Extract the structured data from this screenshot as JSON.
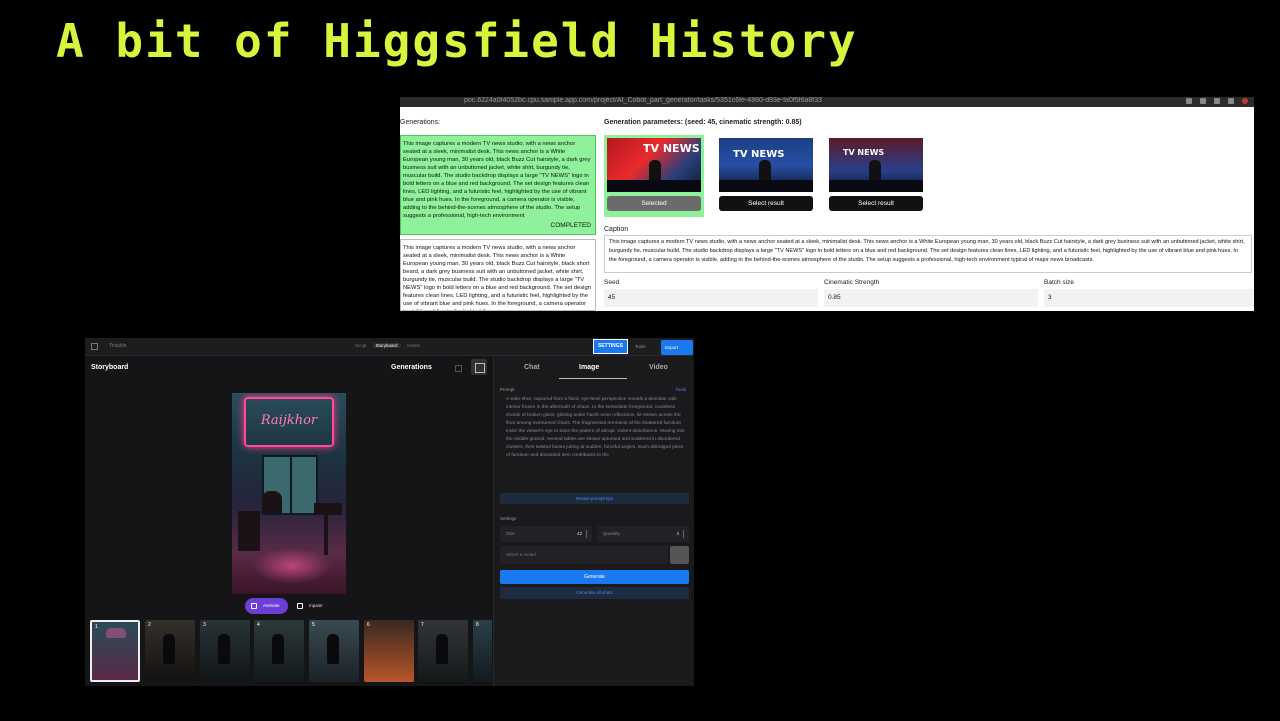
{
  "slide": {
    "title": "A bit of Higgsfield History"
  },
  "colors": {
    "title": "#d8f43c",
    "selected_green": "#8ff19a",
    "accent_blue": "#1a78f0",
    "animate_purple": "#6b3fd6"
  },
  "shot1": {
    "url": "poc.6224a0f4052bc.cpu.sample.app.com/project/AI_Cobot_part_generator/tasks/5351c6fe-4860-d93e-fa0f5f6a8f33",
    "generations_label": "Generations:",
    "generations": [
      {
        "text": "This image captures a modern TV news studio, with a news anchor seated at a sleek, minimalist desk. This news anchor is a White European young man, 30 years old, black Buzz Cut hairstyle, a dark grey business suit with an unbuttoned jacket, white shirt, burgundy tie, muscular build. The studio backdrop displays a large \"TV NEWS\" logo in bold letters on a blue and red background. The set design features clean lines, LED lighting, and a futuristic feel, highlighted by the use of vibrant blue and pink hues. In the foreground, a camera operator is visible, adding to the behind-the-scenes atmosphere of the studio. The setup suggests a professional, high-tech environment",
        "status": "COMPLETED"
      },
      {
        "text": "This image captures a modern TV news studio, with a news anchor seated at a sleek, minimalist desk. This news anchor is a White European young man, 30 years old, black Buzz Cut hairstyle, black short beard, a dark grey business suit with an unbuttoned jacket, white shirt, burgundy tie, muscular build. The studio backdrop displays a large \"TV NEWS\" logo in bold letters on a blue and red background. The set design features clean lines, LED lighting, and a futuristic feel, highlighted by the use of vibrant blue and pink hues. In the foreground, a camera operator is visible, adding to the behind-the-scenes"
      }
    ],
    "params_label": "Generation parameters: (seed: 45, cinematic strength: 0.85)",
    "results": [
      {
        "logo": "TV NEWS",
        "button": "Selected"
      },
      {
        "logo": "TV NEWS",
        "button": "Select result"
      },
      {
        "logo": "TV NEWS",
        "button": "Select result"
      }
    ],
    "caption_label": "Caption",
    "caption_text": "This image captures a modern TV news studio, with a news anchor seated at a sleek, minimalist desk. This news anchor is a White European young man, 30 years old, black Buzz Cut hairstyle, a dark grey business suit with an unbuttoned jacket, white shirt, burgundy tie, muscular build. The studio backdrop displays a large \"TV NEWS\" logo in bold letters on a blue and red background. The set design features clean lines, LED lighting, and a futuristic feel, highlighted by the use of vibrant blue and pink hues. In the foreground, a camera operator is visible, adding to the behind-the-scenes atmosphere of the studio. The setup suggests a professional, high-tech environment typical of major news broadcasts.",
    "fields": [
      {
        "label": "Seed",
        "value": "45"
      },
      {
        "label": "Cinematic Strength",
        "value": "0.85"
      },
      {
        "label": "Batch size",
        "value": "3"
      }
    ]
  },
  "shot2": {
    "project": "Tintable",
    "nav": [
      "Script",
      "Storyboard",
      "Assets"
    ],
    "settings_button": "SETTINGS",
    "tools_label": "Tools",
    "export_button": "Export",
    "storyboard_title": "Storyboard",
    "generations_title": "Generations",
    "neon_sign": "Raijkhor",
    "animate_button": "Animate",
    "inpaint_button": "Inpaint",
    "thumbnails": [
      "1",
      "2",
      "3",
      "4",
      "5",
      "6",
      "7",
      "8"
    ],
    "tabs": [
      "Chat",
      "Image",
      "Video"
    ],
    "active_tab": "Image",
    "prompt_label": "Prompt",
    "prompt_action": "Tools",
    "prompt_text": "A wide-shot, captured from a fixed, eye-level perspective reveals a desolate cafe interior frozen in the aftermath of chaos. In the immediate foreground, countless shards of broken glass, glinting under harsh neon reflections, lie strewn across the floor among overturned chairs. The fragmented remnants of the shattered furniture invite the viewer's eye to trace the pattern of abrupt, violent disturbance. Moving into the middle ground, several tables are shown upturned and scattered in disordered clusters, their twisted bases jutting at sudden, forceful angles. Each dislodged piece of furniture and discarded item contributes to the",
    "prompt_button": "Revise prompt tips",
    "settings_label": "Settings",
    "size": {
      "label": "Size",
      "value": "42"
    },
    "quantity": {
      "label": "Quantity",
      "value": "4"
    },
    "model_placeholder": "Select a model",
    "generate_button": "Generate",
    "generate_all_button": "Generate all shots"
  }
}
